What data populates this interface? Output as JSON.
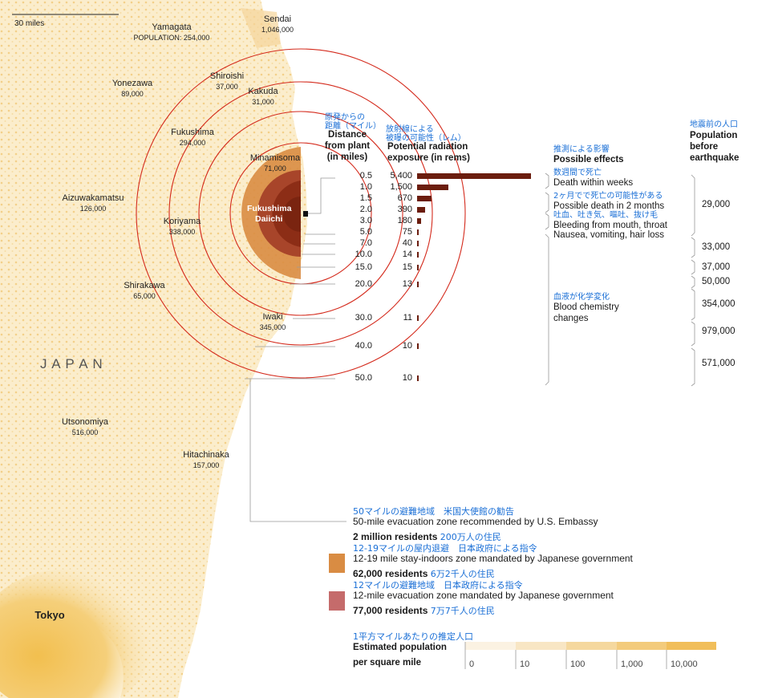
{
  "scale_label": "30 miles",
  "country_label": "J A P A N",
  "plant": {
    "name_line1": "Fukushima",
    "name_line2": "Daiichi"
  },
  "cities": [
    {
      "name": "Sendai",
      "pop": "1,046,000"
    },
    {
      "name": "Yamagata",
      "pop": "POPULATION: 254,000"
    },
    {
      "name": "Shiroishi",
      "pop": "37,000"
    },
    {
      "name": "Yonezawa",
      "pop": "89,000"
    },
    {
      "name": "Kakuda",
      "pop": "31,000"
    },
    {
      "name": "Fukushima",
      "pop": "294,000"
    },
    {
      "name": "Minamisoma",
      "pop": "71,000"
    },
    {
      "name": "Aizuwakamatsu",
      "pop": "126,000"
    },
    {
      "name": "Koriyama",
      "pop": "338,000"
    },
    {
      "name": "Shirakawa",
      "pop": "65,000"
    },
    {
      "name": "Iwaki",
      "pop": "345,000"
    },
    {
      "name": "Utsonomiya",
      "pop": "516,000"
    },
    {
      "name": "Hitachinaka",
      "pop": "157,000"
    },
    {
      "name": "Tokyo",
      "pop": ""
    }
  ],
  "headers": {
    "distance_jp": "原発からの\n距離（マイル）",
    "distance": "Distance\nfrom plant\n(in miles)",
    "exposure_jp": "放射線による\n被曝の可能性（レム）",
    "exposure": "Potential radiation\nexposure (in rems)",
    "effects_jp": "推測による影響",
    "effects": "Possible effects",
    "population_jp": "地震前の人口",
    "population": "Population\nbefore\nearthquake"
  },
  "chart_data": {
    "type": "bar",
    "title": "Potential radiation exposure (in rems)",
    "xlabel": "Distance from plant (in miles)",
    "ylabel": "Potential radiation exposure (in rems)",
    "categories": [
      "0.5",
      "1.0",
      "1.5",
      "2.0",
      "3.0",
      "5.0",
      "7.0",
      "10.0",
      "15.0",
      "20.0",
      "30.0",
      "40.0",
      "50.0"
    ],
    "distance_labels": [
      "0.5",
      "1.0",
      "1.5",
      "2.0",
      "3.0",
      "5.0",
      "7.0",
      "10.0",
      "15.0",
      "20.0",
      "30.0",
      "40.0",
      "50.0"
    ],
    "dose_labels": [
      "5,400",
      "1,500",
      "670",
      "390",
      "180",
      "75",
      "40",
      "14",
      "15",
      "13",
      "11",
      "10",
      "10"
    ],
    "values": [
      5400,
      1500,
      670,
      390,
      180,
      75,
      40,
      14,
      15,
      13,
      11,
      10,
      10
    ],
    "xlim": [
      0,
      5400
    ]
  },
  "effects": [
    {
      "jp": "数週間で死亡",
      "en": "Death within weeks"
    },
    {
      "jp": "2ヶ月でで死亡の可能性がある",
      "en": "Possible death in 2 months"
    },
    {
      "jp": "吐血、吐き気、嘔吐、抜け毛",
      "en": "Bleeding from mouth, throat"
    },
    {
      "jp": "",
      "en": "Nausea, vomiting, hair loss"
    },
    {
      "jp": "血液が化学変化",
      "en": "Blood chemistry\nchanges"
    }
  ],
  "populations": [
    "29,000",
    "33,000",
    "37,000",
    "50,000",
    "354,000",
    "979,000",
    "571,000"
  ],
  "legend": {
    "zone50": {
      "jp": "50マイルの避難地域　米国大使館の勧告",
      "en": "50-mile evacuation zone recommended by U.S. Embassy",
      "residents": "2 million residents",
      "residents_jp": "200万人の住民"
    },
    "zone1219": {
      "jp": "12-19マイルの屋内退避　日本政府による指令",
      "en": "12-19 mile stay-indoors zone mandated by Japanese government",
      "residents": "62,000 residents",
      "residents_jp": "6万2千人の住民",
      "color": "#d98c43"
    },
    "zone12": {
      "jp": "12マイルの避難地域　日本政府による指令",
      "en": "12-mile evacuation zone mandated by Japanese government",
      "residents": "77,000 residents",
      "residents_jp": "7万7千人の住民",
      "color": "#c56b6b"
    }
  },
  "density": {
    "title_jp": "1平方マイルあたりの推定人口",
    "title_line1": "Estimated population",
    "title_line2": "per square mile",
    "ticks": [
      "0",
      "10",
      "100",
      "1,000",
      "10,000"
    ],
    "colors": [
      "#fbf2e2",
      "#f8e6c4",
      "#f5d89e",
      "#f3cb7c",
      "#f1be5a"
    ]
  },
  "colors": {
    "ring": "#d42a1c",
    "bar": "#6b1d0e",
    "land": "#fdf6e3",
    "japanese_text": "#1a6fd6"
  }
}
